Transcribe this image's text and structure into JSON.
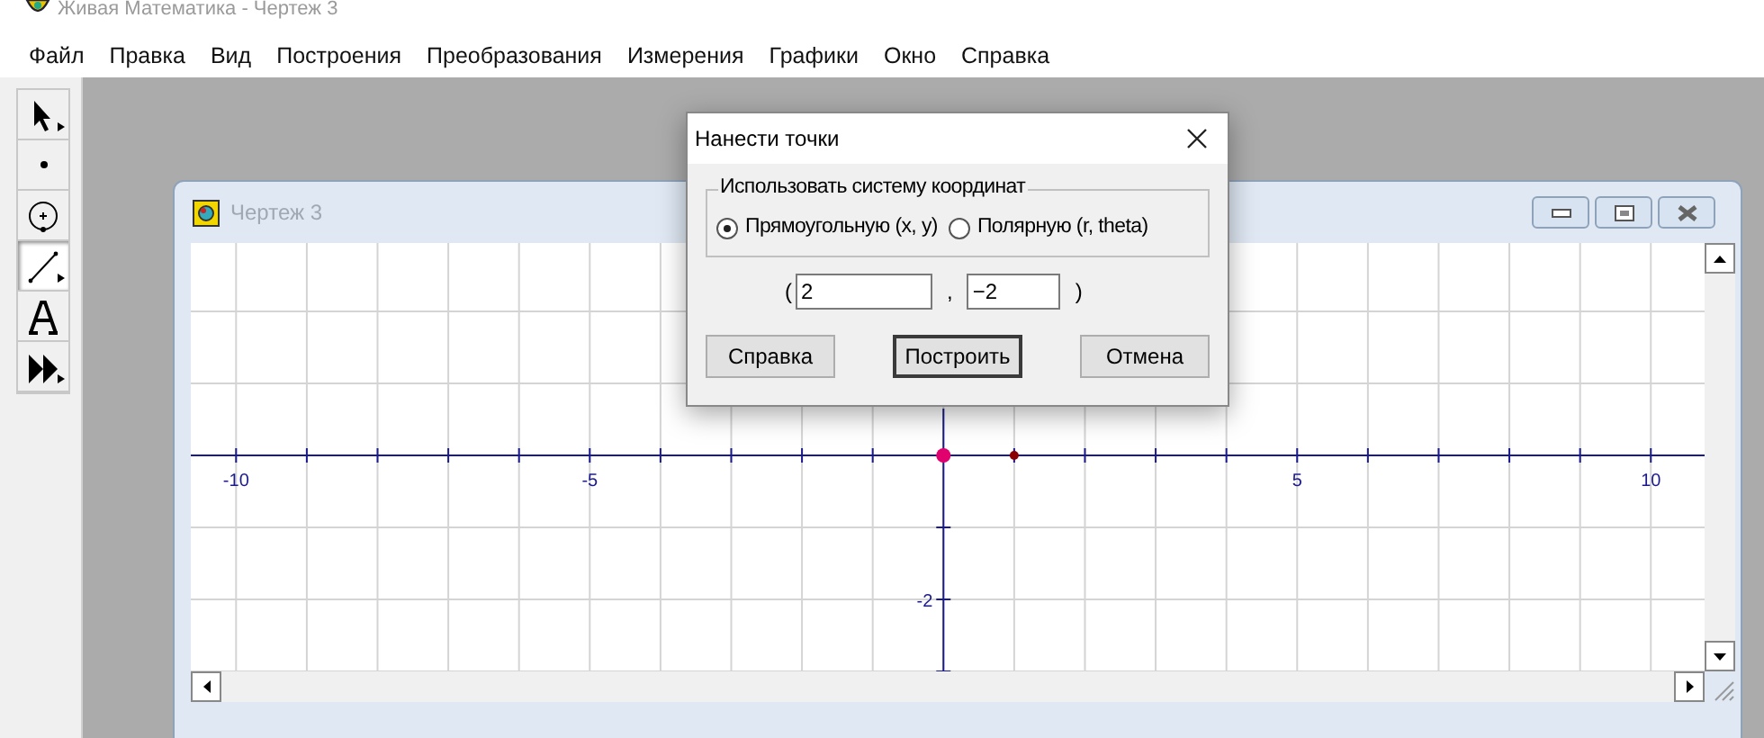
{
  "app_title": "Живая Математика - Чертеж 3",
  "menu": [
    "Файл",
    "Правка",
    "Вид",
    "Построения",
    "Преобразования",
    "Измерения",
    "Графики",
    "Окно",
    "Справка"
  ],
  "tools": [
    {
      "kind": "arrow",
      "selected": false
    },
    {
      "kind": "point",
      "selected": false
    },
    {
      "kind": "compass",
      "selected": false
    },
    {
      "kind": "line",
      "selected": true
    },
    {
      "kind": "text",
      "selected": false
    },
    {
      "kind": "custom",
      "selected": false
    }
  ],
  "document": {
    "title": "Чертеж 3",
    "x_axis_labels": [
      "-10",
      "-5",
      "5",
      "10"
    ],
    "y_axis_labels": [
      "-2"
    ],
    "points": [
      {
        "color": "#e0006e"
      },
      {
        "color": "#8b0000"
      }
    ]
  },
  "dialog": {
    "title": "Нанести точки",
    "group_label": "Использовать систему координат",
    "options": [
      {
        "label": "Прямоугольную (x, y)",
        "selected": true
      },
      {
        "label": "Полярную (r, theta)",
        "selected": false
      }
    ],
    "open_paren": "(",
    "x_value": "2",
    "separator": ",",
    "y_value": "−2",
    "close_paren": ")",
    "buttons": [
      {
        "label": "Справка",
        "default": false
      },
      {
        "label": "Построить",
        "default": true
      },
      {
        "label": "Отмена",
        "default": false
      }
    ]
  }
}
